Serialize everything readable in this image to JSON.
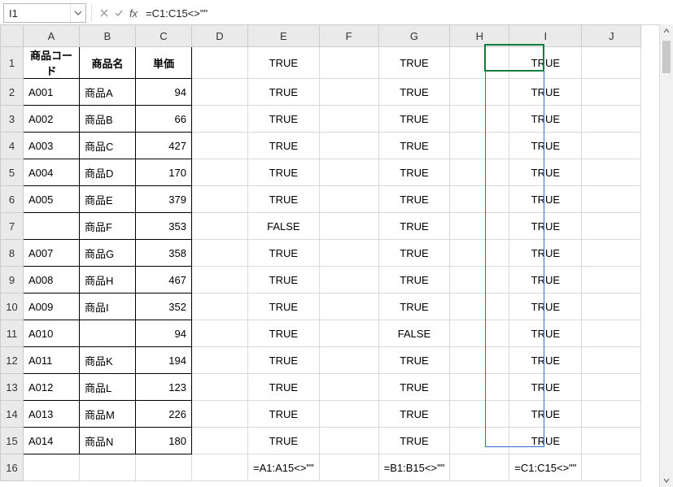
{
  "name_box": {
    "value": "I1"
  },
  "formula_bar": {
    "formula": "=C1:C15<>\"\""
  },
  "columns": [
    "A",
    "B",
    "C",
    "D",
    "E",
    "F",
    "G",
    "H",
    "I",
    "J"
  ],
  "rows": [
    "1",
    "2",
    "3",
    "4",
    "5",
    "6",
    "7",
    "8",
    "9",
    "10",
    "11",
    "12",
    "13",
    "14",
    "15",
    "16"
  ],
  "table": {
    "headers": {
      "A": "商品コード",
      "B": "商品名",
      "C": "単価"
    },
    "data": [
      {
        "code": "A001",
        "name": "商品A",
        "price": "94"
      },
      {
        "code": "A002",
        "name": "商品B",
        "price": "66"
      },
      {
        "code": "A003",
        "name": "商品C",
        "price": "427"
      },
      {
        "code": "A004",
        "name": "商品D",
        "price": "170"
      },
      {
        "code": "A005",
        "name": "商品E",
        "price": "379"
      },
      {
        "code": "",
        "name": "商品F",
        "price": "353"
      },
      {
        "code": "A007",
        "name": "商品G",
        "price": "358"
      },
      {
        "code": "A008",
        "name": "商品H",
        "price": "467"
      },
      {
        "code": "A009",
        "name": "商品I",
        "price": "352"
      },
      {
        "code": "A010",
        "name": "",
        "price": "94"
      },
      {
        "code": "A011",
        "name": "商品K",
        "price": "194"
      },
      {
        "code": "A012",
        "name": "商品L",
        "price": "123"
      },
      {
        "code": "A013",
        "name": "商品M",
        "price": "226"
      },
      {
        "code": "A014",
        "name": "商品N",
        "price": "180"
      }
    ]
  },
  "results": {
    "E": [
      "TRUE",
      "TRUE",
      "TRUE",
      "TRUE",
      "TRUE",
      "TRUE",
      "FALSE",
      "TRUE",
      "TRUE",
      "TRUE",
      "TRUE",
      "TRUE",
      "TRUE",
      "TRUE",
      "TRUE"
    ],
    "G": [
      "TRUE",
      "TRUE",
      "TRUE",
      "TRUE",
      "TRUE",
      "TRUE",
      "TRUE",
      "TRUE",
      "TRUE",
      "TRUE",
      "FALSE",
      "TRUE",
      "TRUE",
      "TRUE",
      "TRUE"
    ],
    "I": [
      "TRUE",
      "TRUE",
      "TRUE",
      "TRUE",
      "TRUE",
      "TRUE",
      "TRUE",
      "TRUE",
      "TRUE",
      "TRUE",
      "TRUE",
      "TRUE",
      "TRUE",
      "TRUE",
      "TRUE"
    ]
  },
  "annotations": {
    "E16": "=A1:A15<>\"\"",
    "G16": "=B1:B15<>\"\"",
    "I16": "=C1:C15<>\"\""
  },
  "selection": {
    "active": "I1",
    "spill": "I1:I15"
  }
}
